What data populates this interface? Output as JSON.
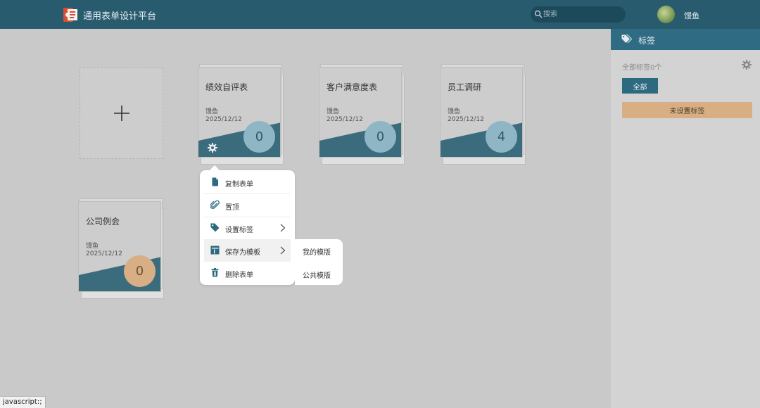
{
  "header": {
    "app_title": "通用表单设计平台",
    "search_placeholder": "搜索",
    "username": "馒鱼"
  },
  "sidebar": {
    "title": "标签",
    "tag_count": "全部标签0个",
    "all_button": "全部",
    "untagged_button": "未设置标签"
  },
  "forms": [
    {
      "title": "绩效自评表",
      "author": "馒鱼",
      "date": "2025/12/12",
      "count": "0"
    },
    {
      "title": "客户满意度表",
      "author": "馒鱼",
      "date": "2025/12/12",
      "count": "0"
    },
    {
      "title": "员工调研",
      "author": "馒鱼",
      "date": "2025/12/12",
      "count": "4"
    },
    {
      "title": "公司例会",
      "author": "馒鱼",
      "date": "2025/12/12",
      "count": "0"
    }
  ],
  "context_menu": {
    "items": [
      {
        "label": "复制表单"
      },
      {
        "label": "置顶"
      },
      {
        "label": "设置标签"
      },
      {
        "label": "保存为模板"
      },
      {
        "label": "删除表单"
      }
    ],
    "submenu": [
      "我的模版",
      "公共模版"
    ]
  },
  "status_bar": "javascript:;",
  "colors": {
    "header": "#285b6e",
    "accent": "#2d6a80",
    "wedge": "#3b6c7e",
    "count_blue": "#8fb6c5",
    "count_orange": "#d8ae84"
  }
}
